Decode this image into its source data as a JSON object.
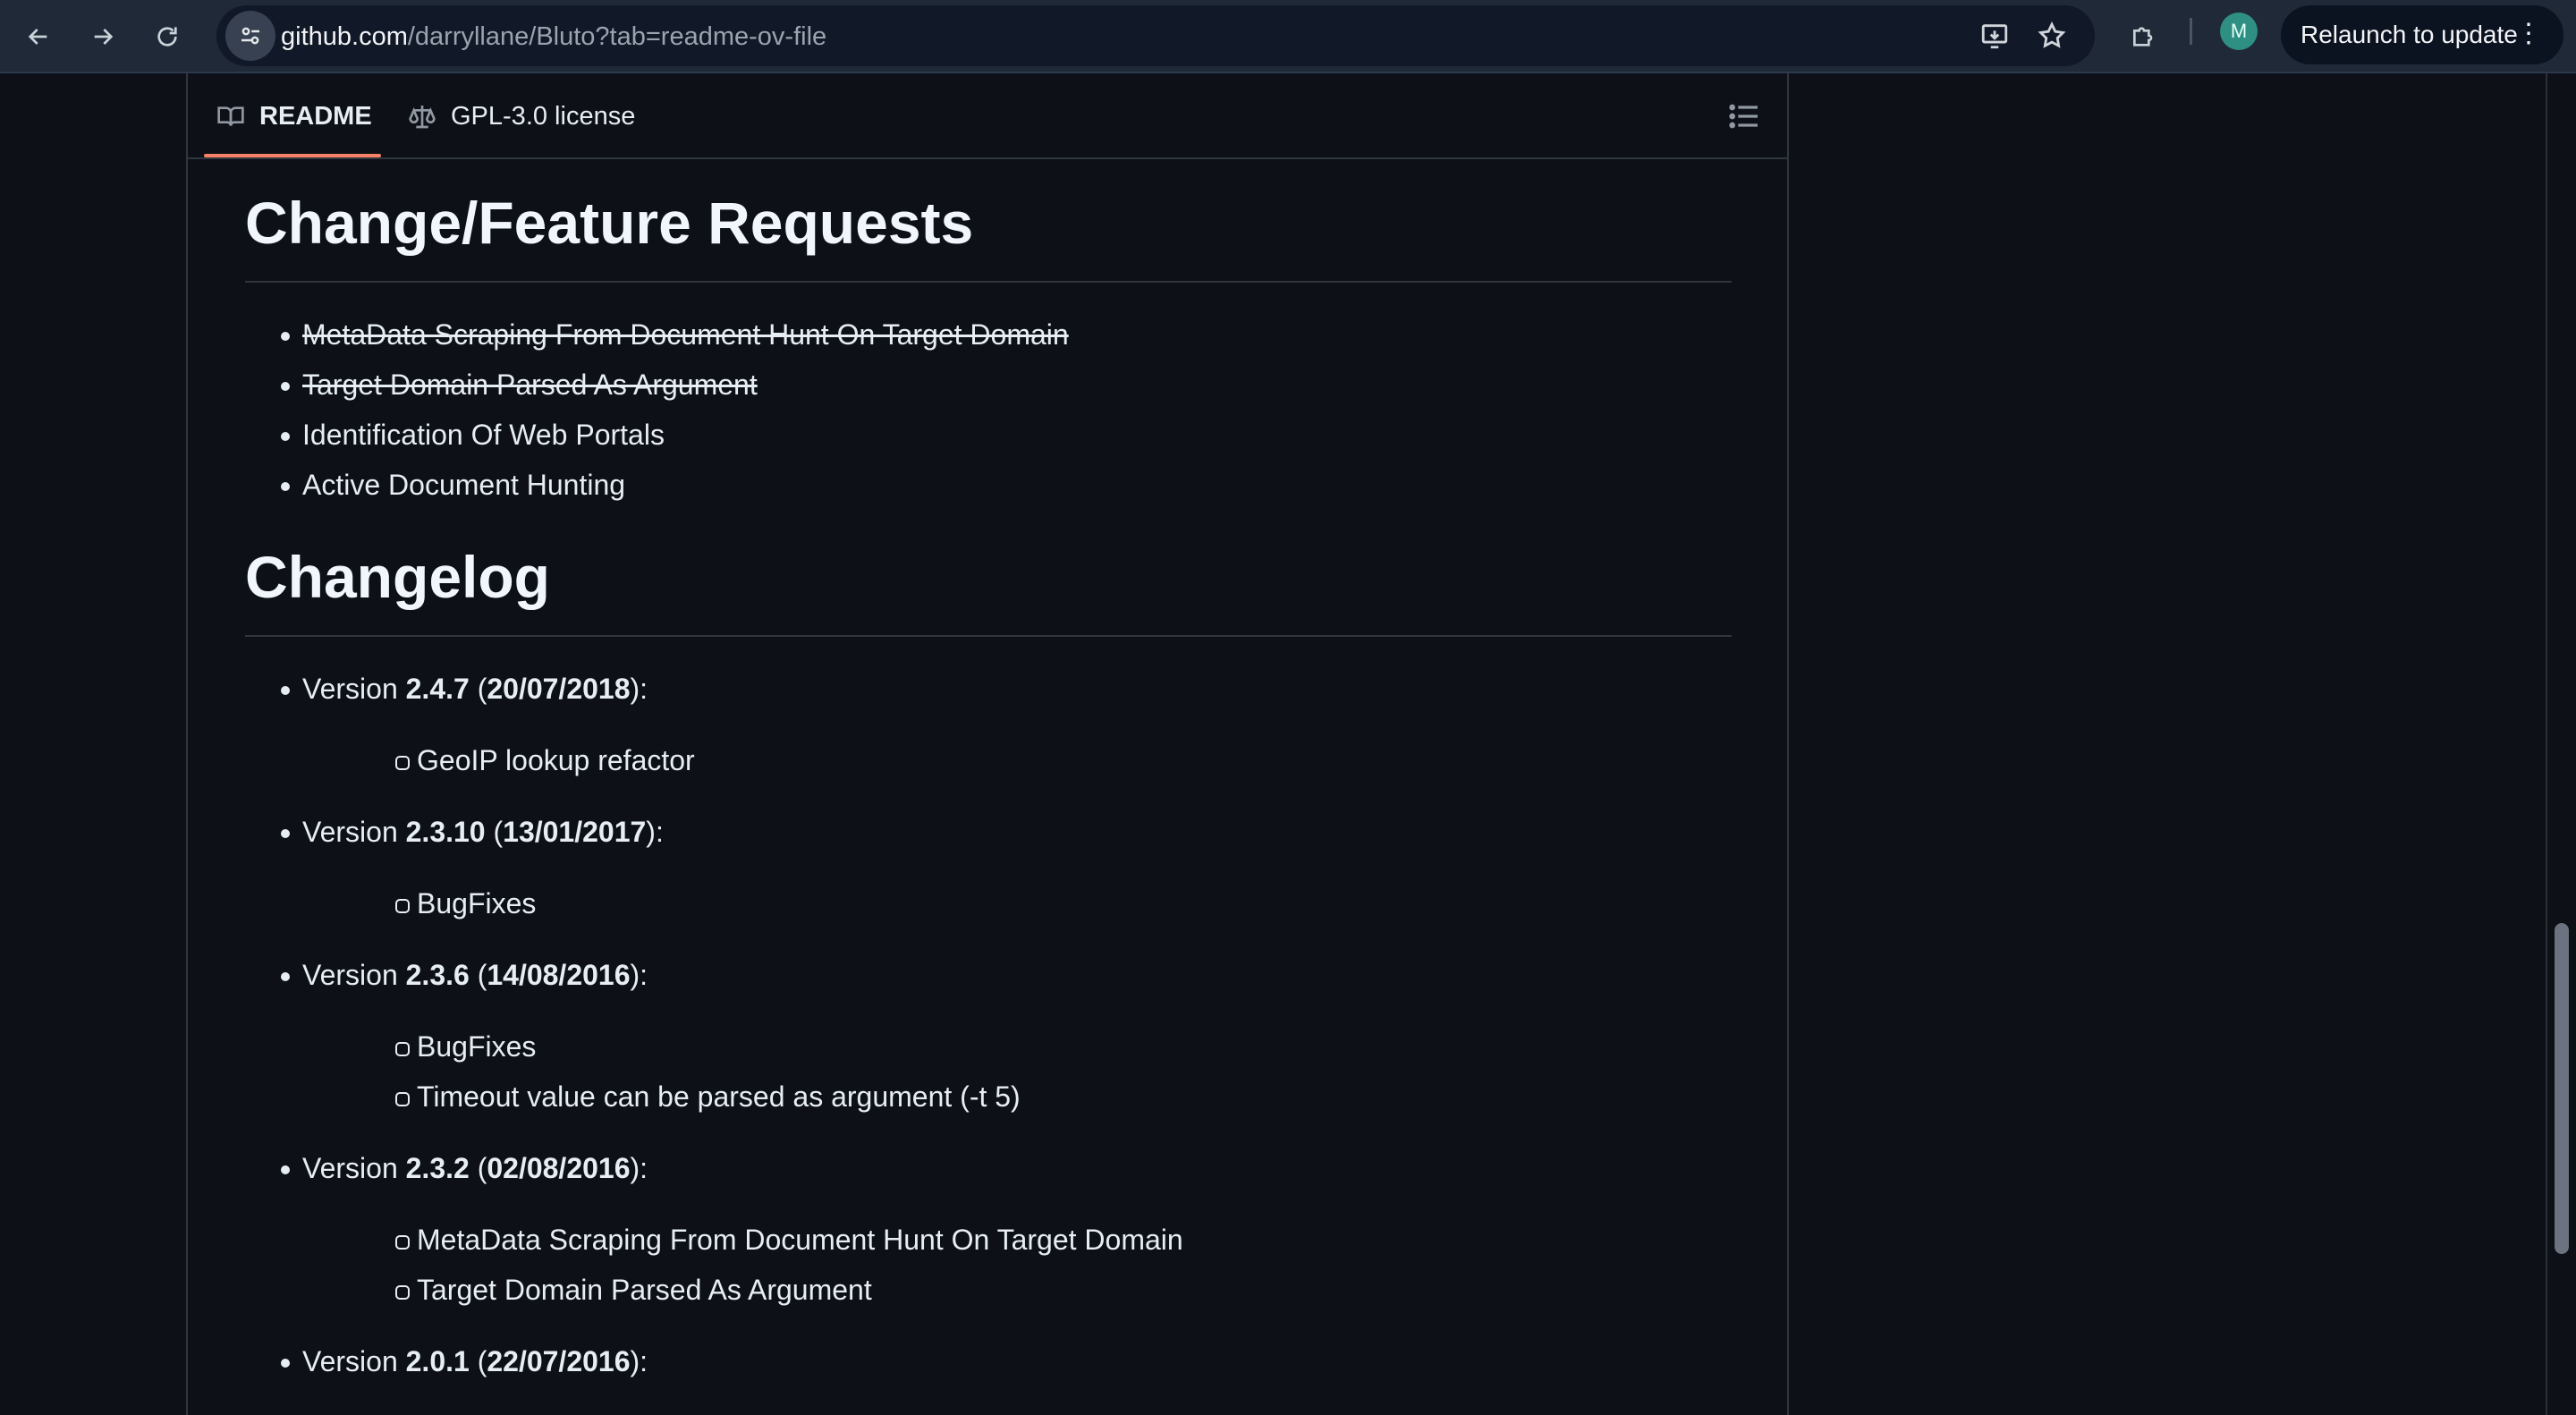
{
  "browser": {
    "url_host": "github.com",
    "url_path": "/darryllane/Bluto?tab=readme-ov-file",
    "relaunch_label": "Relaunch to update",
    "profile_initial": "M"
  },
  "readme_tabs": [
    {
      "label": "README",
      "icon": "book-icon",
      "active": true
    },
    {
      "label": "GPL-3.0 license",
      "icon": "scale-icon",
      "active": false
    }
  ],
  "sections": {
    "features_title": "Change/Feature Requests",
    "features": [
      {
        "text": "MetaData Scraping From Document Hunt On Target Domain",
        "done": true
      },
      {
        "text": "Target Domain Parsed As Argument",
        "done": true
      },
      {
        "text": "Identification Of Web Portals",
        "done": false
      },
      {
        "text": "Active Document Hunting",
        "done": false
      }
    ],
    "changelog_title": "Changelog",
    "changelog": [
      {
        "prefix": "Version ",
        "version": "2.4.7",
        "open": " (",
        "date": "20/07/2018",
        "close": "):",
        "items": [
          "GeoIP lookup refactor"
        ]
      },
      {
        "prefix": "Version ",
        "version": "2.3.10",
        "open": " (",
        "date": "13/01/2017",
        "close": "):",
        "items": [
          "BugFixes"
        ]
      },
      {
        "prefix": "Version ",
        "version": "2.3.6",
        "open": " (",
        "date": "14/08/2016",
        "close": "):",
        "items": [
          "BugFixes",
          "Timeout value can be parsed as argument (-t 5)"
        ]
      },
      {
        "prefix": "Version ",
        "version": "2.3.2",
        "open": " (",
        "date": "02/08/2016",
        "close": "):",
        "items": [
          "MetaData Scraping From Document Hunt On Target Domain",
          "Target Domain Parsed As Argument"
        ]
      },
      {
        "prefix": "Version ",
        "version": "2.0.1",
        "open": " (",
        "date": "22/07/2016",
        "close": "):",
        "items": []
      }
    ]
  },
  "colors": {
    "background": "#0d1117",
    "accent_underline": "#f78166",
    "border": "#30363d"
  }
}
